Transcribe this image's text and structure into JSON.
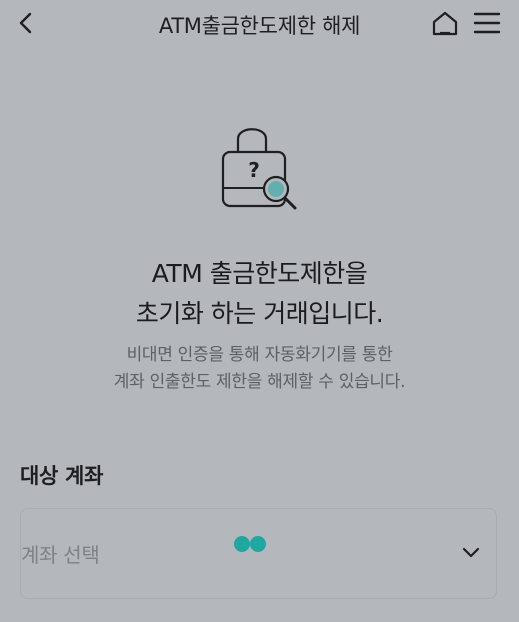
{
  "header": {
    "title": "ATM출금한도제한 해제",
    "back_icon": "chevron-left-icon",
    "home_icon": "home-icon",
    "menu_icon": "hamburger-menu-icon"
  },
  "hero": {
    "icon": "lock-question-search-icon"
  },
  "main": {
    "headline_line1": "ATM 출금한도제한을",
    "headline_line2": "초기화 하는 거래입니다.",
    "desc_line1": "비대면 인증을 통해 자동화기기를 통한",
    "desc_line2": "계좌 인출한도 제한을 해제할 수 있습니다."
  },
  "account": {
    "label": "대상 계좌",
    "select_placeholder": "계좌 선택",
    "dropdown_icon": "chevron-down-icon"
  },
  "colors": {
    "background": "#b4b8bd",
    "text": "#1d1f22",
    "muted": "#5d6166",
    "loader": "#1fa7a0"
  }
}
